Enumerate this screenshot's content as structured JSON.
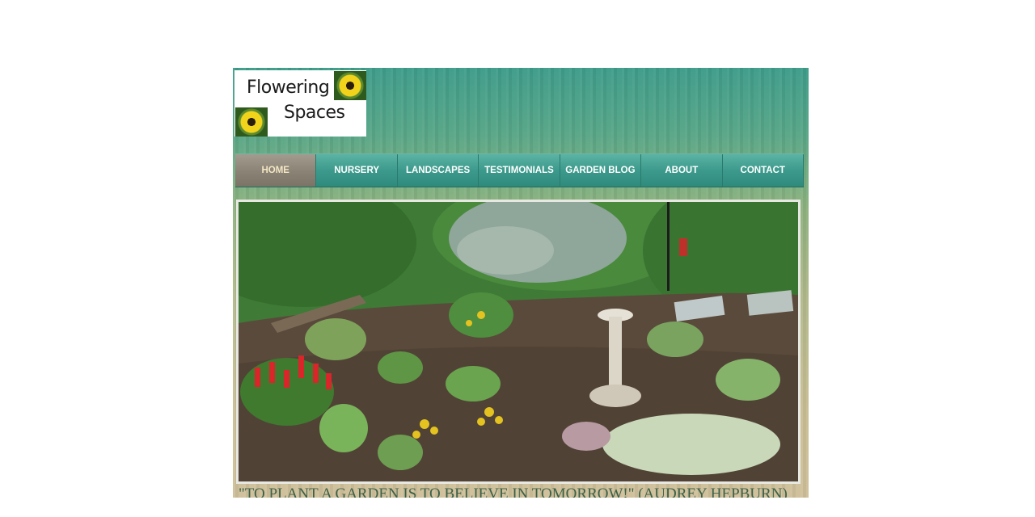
{
  "logo": {
    "line1": "Flowering",
    "line2": "Spaces"
  },
  "nav": {
    "items": [
      {
        "label": "HOME",
        "active": true
      },
      {
        "label": "NURSERY"
      },
      {
        "label": "LANDSCAPES"
      },
      {
        "label": "TESTIMONIALS"
      },
      {
        "label": "GARDEN BLOG"
      },
      {
        "label": "ABOUT"
      },
      {
        "label": "CONTACT"
      }
    ]
  },
  "quote": "\"TO PLANT A GARDEN IS TO BELIEVE IN TOMORROW!\" (AUDREY HEPBURN)",
  "colors": {
    "nav_teal": "#3c9a8c",
    "nav_active": "#8a8275",
    "quote_text": "#3c6048",
    "background_top": "#3f9c8a",
    "background_bottom": "#cfc09a"
  }
}
